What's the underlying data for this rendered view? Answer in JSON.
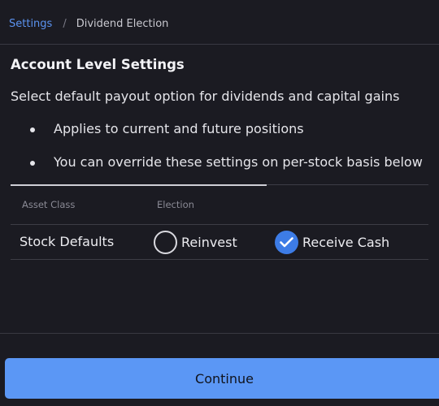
{
  "breadcrumb": {
    "parent": "Settings",
    "separator": "/",
    "current": "Dividend Election"
  },
  "section": {
    "title": "Account Level Settings",
    "description": "Select default payout option for dividends and capital gains",
    "bullets": [
      "Applies to current and future positions",
      "You can override these settings on per-stock basis below"
    ]
  },
  "table": {
    "headers": {
      "asset_class": "Asset Class",
      "election": "Election"
    },
    "rows": [
      {
        "asset_class": "Stock Defaults",
        "options": [
          {
            "label": "Reinvest",
            "selected": false
          },
          {
            "label": "Receive Cash",
            "selected": true
          }
        ]
      }
    ]
  },
  "footer": {
    "continue_label": "Continue"
  },
  "colors": {
    "background": "#1b1b22",
    "accent": "#3d7ce6",
    "button": "#5b97f5",
    "link": "#5b93f0"
  },
  "icons": {
    "radio_checked": "checkmark-icon"
  }
}
